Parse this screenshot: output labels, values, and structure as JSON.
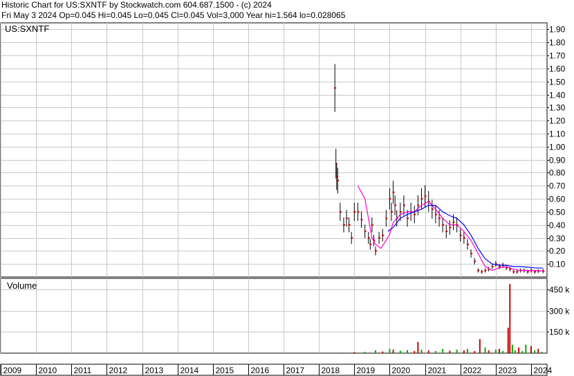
{
  "header": {
    "line1": "Historic Chart for US:SXNTF by Stockwatch.com 604.687.1500 - (c) 2024",
    "line2": "Fri May  3 2024  Op=0.045  Hi=0.045  Lo=0.045  Cl=0.045  Vol=3,000  Year hi=1.564  lo=0.028065"
  },
  "chart_data": [
    {
      "type": "line",
      "panel": "price",
      "title": "US:SXNTF",
      "ylim": [
        0,
        1.95
      ],
      "y_ticks": [
        "1.90",
        "1.80",
        "1.70",
        "1.60",
        "1.50",
        "1.40",
        "1.30",
        "1.20",
        "1.10",
        "1.00",
        "0.90",
        "0.80",
        "0.70",
        "0.60",
        "0.50",
        "0.40",
        "0.30",
        "0.20",
        "0.10"
      ],
      "x_ticks": [
        "2009",
        "2010",
        "2011",
        "2012",
        "2013",
        "2014",
        "2015",
        "2016",
        "2017",
        "2018",
        "2019",
        "2020",
        "2021",
        "2022",
        "2023",
        "2024"
      ],
      "grid": true,
      "colors": {
        "price": "#000000",
        "close_marker": "#cc0000",
        "ma_short": "#ff00cc",
        "ma_long": "#0000ff"
      },
      "series": [
        {
          "key": "price",
          "x": [
            2018.45,
            2018.48,
            2018.5,
            2018.53,
            2018.6,
            2018.7,
            2018.78,
            2018.85,
            2018.92,
            2019.0,
            2019.1,
            2019.2,
            2019.3,
            2019.4,
            2019.45,
            2019.5,
            2019.55,
            2019.6,
            2019.7,
            2019.8,
            2019.9,
            2020.0,
            2020.05,
            2020.1,
            2020.15,
            2020.2,
            2020.3,
            2020.4,
            2020.5,
            2020.6,
            2020.7,
            2020.8,
            2020.9,
            2021.0,
            2021.1,
            2021.2,
            2021.3,
            2021.4,
            2021.5,
            2021.6,
            2021.7,
            2021.8,
            2021.9,
            2022.0,
            2022.1,
            2022.2,
            2022.3,
            2022.4,
            2022.5,
            2022.6,
            2022.7,
            2022.8,
            2022.9,
            2023.0,
            2023.1,
            2023.2,
            2023.3,
            2023.4,
            2023.5,
            2023.6,
            2023.7,
            2023.8,
            2023.9,
            2024.0,
            2024.1,
            2024.2,
            2024.34
          ],
          "values": [
            1.45,
            0.87,
            0.77,
            0.74,
            0.5,
            0.4,
            0.45,
            0.4,
            0.3,
            0.5,
            0.5,
            0.44,
            0.35,
            0.3,
            0.25,
            0.4,
            0.28,
            0.2,
            0.3,
            0.32,
            0.45,
            0.6,
            0.5,
            0.65,
            0.55,
            0.45,
            0.5,
            0.55,
            0.45,
            0.5,
            0.48,
            0.55,
            0.6,
            0.62,
            0.58,
            0.52,
            0.48,
            0.45,
            0.4,
            0.35,
            0.38,
            0.42,
            0.4,
            0.32,
            0.3,
            0.25,
            0.18,
            0.12,
            0.05,
            0.04,
            0.05,
            0.06,
            0.08,
            0.1,
            0.08,
            0.09,
            0.07,
            0.06,
            0.04,
            0.04,
            0.05,
            0.05,
            0.04,
            0.05,
            0.04,
            0.045,
            0.045
          ]
        },
        {
          "key": "ma_short",
          "x": [
            2019.1,
            2019.3,
            2019.5,
            2019.6,
            2019.75,
            2019.9,
            2020.0,
            2020.1,
            2020.3,
            2020.5,
            2020.7,
            2020.9,
            2021.1,
            2021.3,
            2021.5,
            2021.7,
            2021.9,
            2022.1,
            2022.3,
            2022.5,
            2022.7,
            2022.9,
            2023.1,
            2023.3,
            2023.5,
            2023.7,
            2023.9,
            2024.1,
            2024.34
          ],
          "values": [
            0.7,
            0.6,
            0.3,
            0.25,
            0.22,
            0.28,
            0.33,
            0.42,
            0.48,
            0.5,
            0.5,
            0.55,
            0.58,
            0.52,
            0.45,
            0.4,
            0.4,
            0.35,
            0.28,
            0.18,
            0.08,
            0.05,
            0.07,
            0.08,
            0.06,
            0.05,
            0.05,
            0.05,
            0.045
          ]
        },
        {
          "key": "ma_long",
          "x": [
            2019.95,
            2020.1,
            2020.3,
            2020.5,
            2020.7,
            2020.9,
            2021.1,
            2021.3,
            2021.5,
            2021.7,
            2021.9,
            2022.1,
            2022.3,
            2022.5,
            2022.7,
            2022.9,
            2023.1,
            2023.3,
            2023.5,
            2023.7,
            2023.9,
            2024.1,
            2024.34
          ],
          "values": [
            0.35,
            0.38,
            0.45,
            0.48,
            0.5,
            0.52,
            0.55,
            0.55,
            0.5,
            0.47,
            0.45,
            0.4,
            0.32,
            0.22,
            0.14,
            0.1,
            0.09,
            0.09,
            0.08,
            0.08,
            0.075,
            0.07,
            0.068
          ]
        }
      ]
    },
    {
      "type": "bar",
      "panel": "volume",
      "title": "Volume",
      "ylim": [
        0,
        530
      ],
      "y_ticks": [
        "450 k",
        "300 k",
        "150 k"
      ],
      "y_units": "thousand shares",
      "colors": {
        "up": "#00aa00",
        "down": "#cc0000"
      },
      "x": [
        2018.7,
        2019.0,
        2019.3,
        2019.6,
        2019.8,
        2020.0,
        2020.1,
        2020.3,
        2020.5,
        2020.7,
        2020.8,
        2020.9,
        2021.1,
        2021.3,
        2021.5,
        2021.7,
        2021.9,
        2022.1,
        2022.2,
        2022.4,
        2022.55,
        2022.7,
        2022.8,
        2023.0,
        2023.1,
        2023.2,
        2023.35,
        2023.4,
        2023.47,
        2023.55,
        2023.65,
        2023.75,
        2023.85,
        2024.0,
        2024.1,
        2024.2,
        2024.3
      ],
      "values": [
        5,
        8,
        10,
        20,
        12,
        30,
        25,
        18,
        22,
        15,
        80,
        25,
        20,
        15,
        30,
        18,
        25,
        20,
        30,
        15,
        100,
        40,
        20,
        25,
        30,
        15,
        180,
        490,
        60,
        20,
        40,
        15,
        60,
        50,
        20,
        30,
        10
      ],
      "directions": [
        "up",
        "down",
        "up",
        "up",
        "down",
        "up",
        "down",
        "up",
        "up",
        "down",
        "down",
        "up",
        "down",
        "up",
        "up",
        "down",
        "up",
        "down",
        "up",
        "down",
        "down",
        "up",
        "down",
        "up",
        "down",
        "up",
        "down",
        "down",
        "up",
        "up",
        "down",
        "up",
        "up",
        "down",
        "up",
        "down",
        "up"
      ]
    }
  ]
}
